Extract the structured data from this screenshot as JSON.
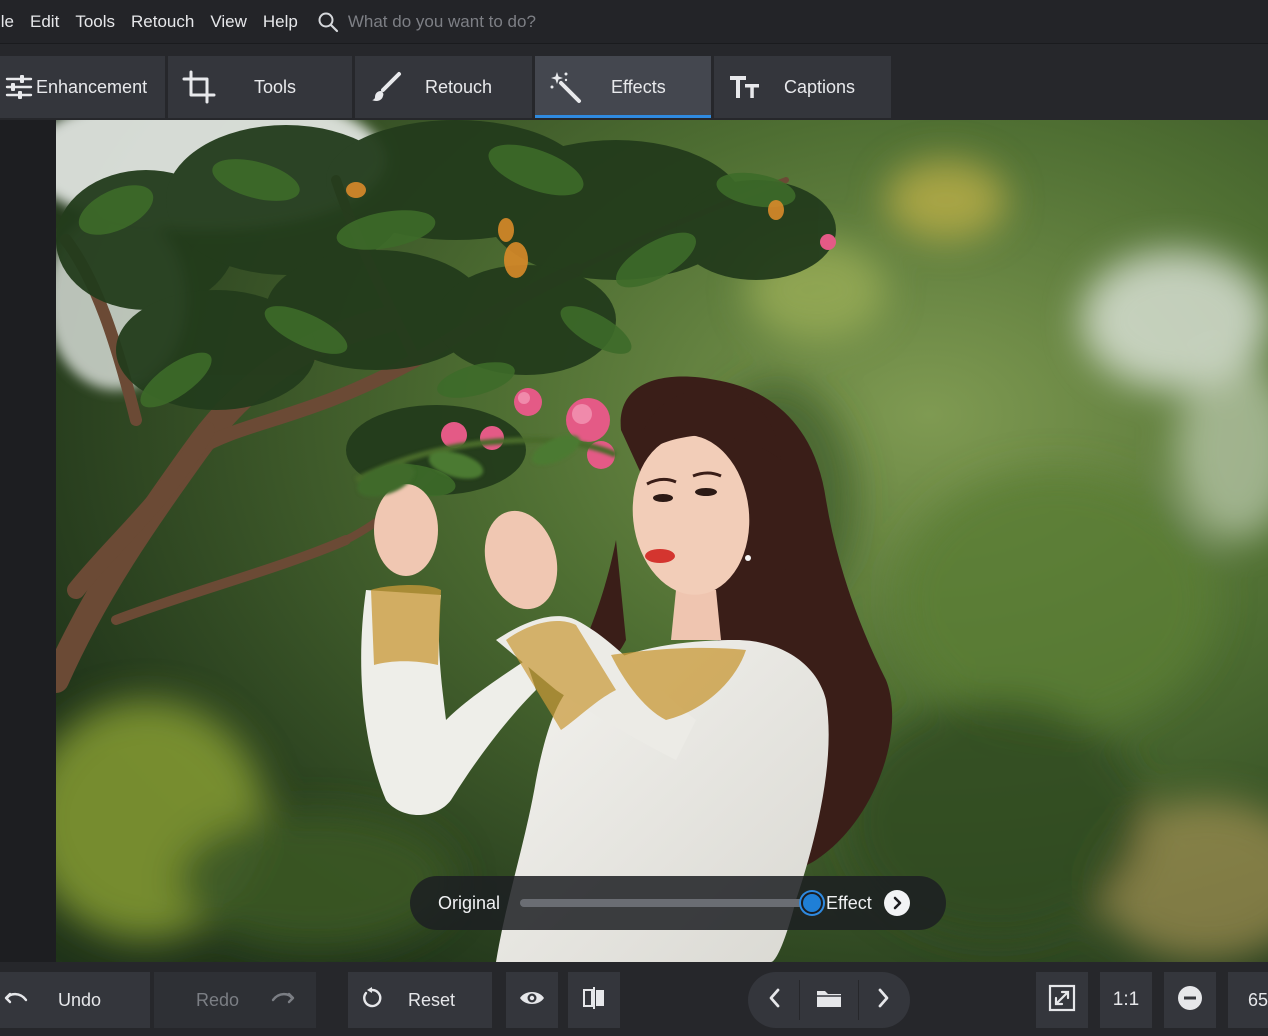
{
  "menu": {
    "items": [
      {
        "label": "ile"
      },
      {
        "label": "Edit"
      },
      {
        "label": "Tools"
      },
      {
        "label": "Retouch"
      },
      {
        "label": "View"
      },
      {
        "label": "Help"
      }
    ],
    "search_placeholder": "What do you want to do?"
  },
  "tabs": [
    {
      "label": "Enhancement",
      "icon": "sliders-icon",
      "active": false
    },
    {
      "label": "Tools",
      "icon": "crop-icon",
      "active": false
    },
    {
      "label": "Retouch",
      "icon": "brush-icon",
      "active": false
    },
    {
      "label": "Effects",
      "icon": "magic-wand-icon",
      "active": true
    },
    {
      "label": "Captions",
      "icon": "text-size-icon",
      "active": false
    }
  ],
  "compare": {
    "original_label": "Original",
    "effect_label": "Effect",
    "slider_value": 1.0
  },
  "bottom": {
    "undo_label": "Undo",
    "redo_label": "Redo",
    "reset_label": "Reset",
    "actual_size_label": "1:1",
    "zoom_partial": "65"
  },
  "colors": {
    "accent": "#2f8ae0",
    "panel": "#26272b",
    "button": "#34363c"
  }
}
